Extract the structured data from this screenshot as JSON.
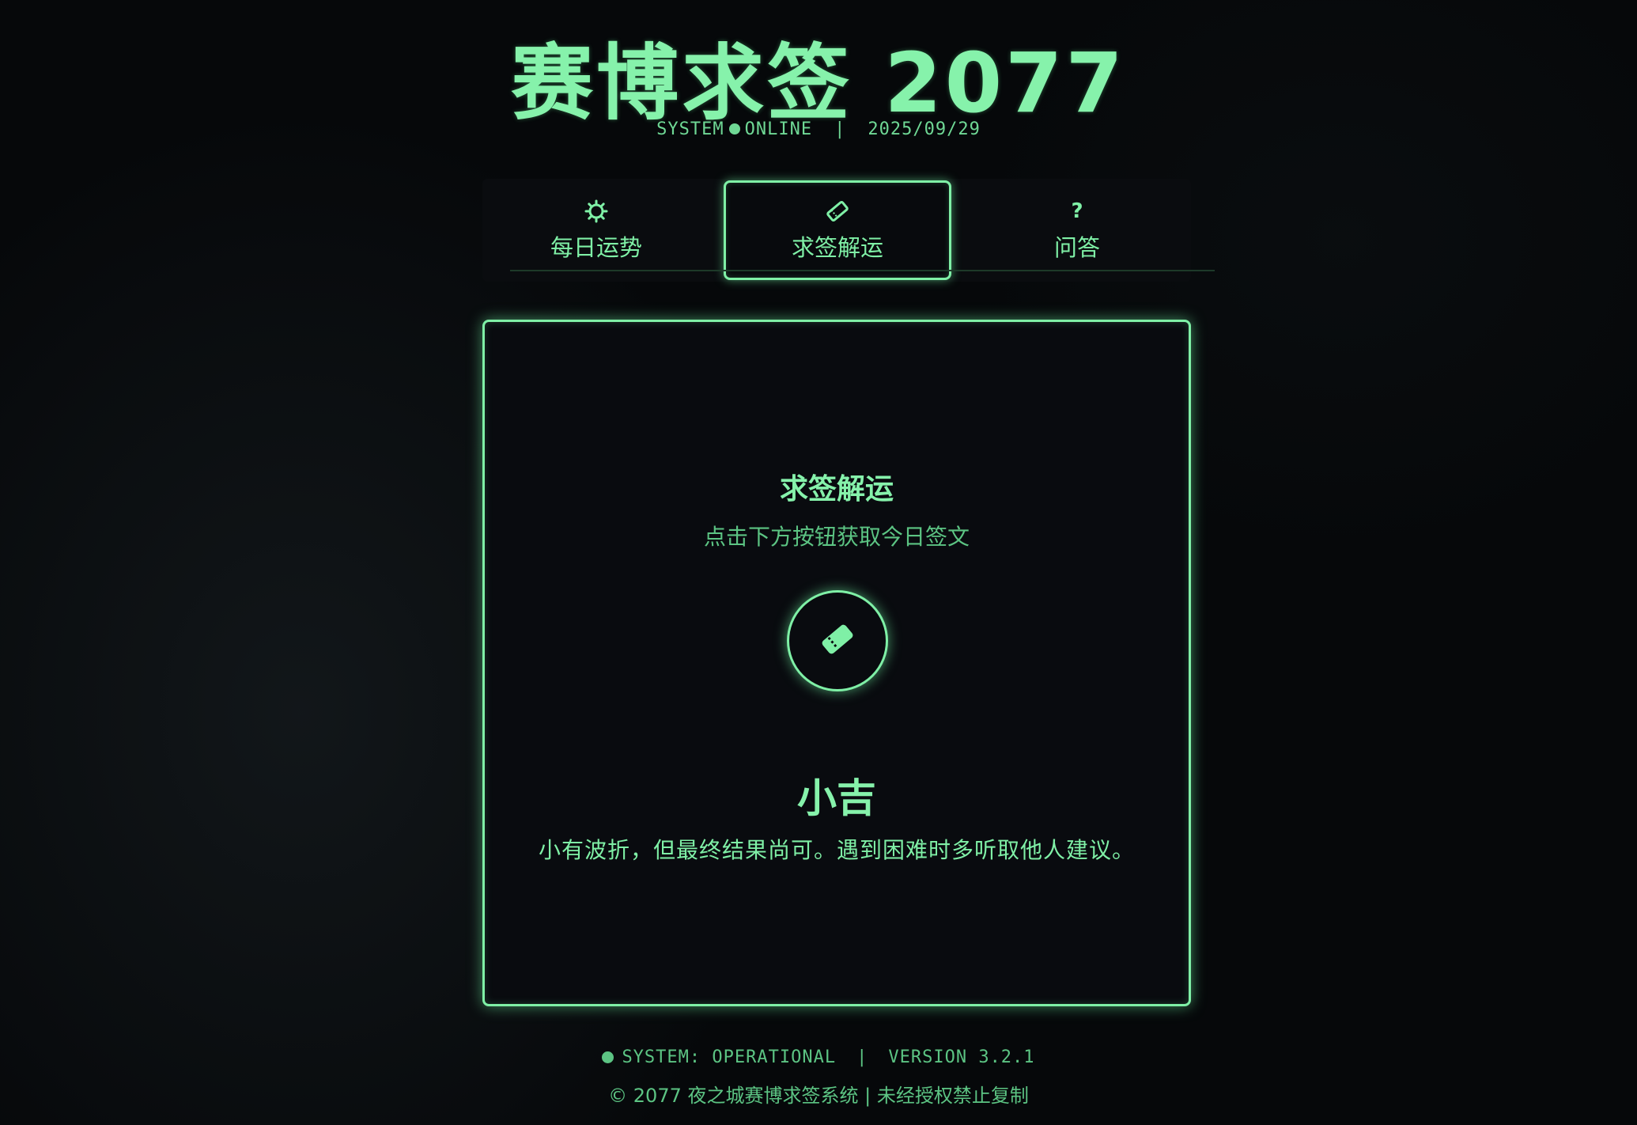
{
  "header": {
    "title": "赛博求签 2077",
    "status_left": "SYSTEM",
    "status_right": "ONLINE",
    "separator": "|",
    "date": "2025/09/29"
  },
  "tabs": [
    {
      "label": "每日运势",
      "icon": "sun-icon"
    },
    {
      "label": "求签解运",
      "icon": "ticket-icon",
      "active": true
    },
    {
      "label": "问答",
      "icon": "question-icon",
      "glyph": "?"
    }
  ],
  "card": {
    "title": "求签解运",
    "hint": "点击下方按钮获取今日签文",
    "draw_button_icon": "ticket-icon",
    "result_title": "小吉",
    "result_text": "小有波折，但最终结果尚可。遇到困难时多听取他人建议。"
  },
  "footer": {
    "status": "SYSTEM: OPERATIONAL",
    "separator": "|",
    "version": "VERSION 3.2.1",
    "copyright": "© 2077 夜之城赛博求签系统 | 未经授权禁止复制"
  },
  "colors": {
    "accent": "#7ff0a6",
    "background": "#06080a",
    "muted": "#5cc483"
  }
}
